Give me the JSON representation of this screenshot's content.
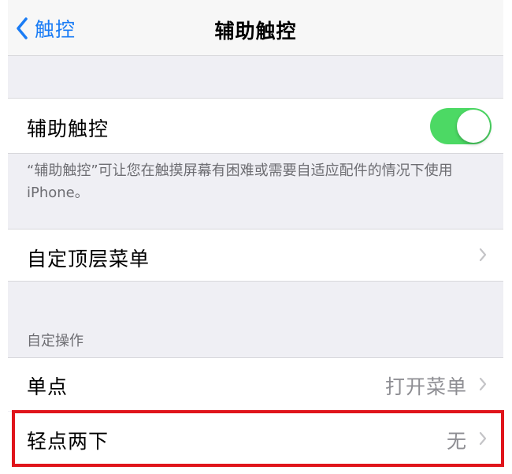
{
  "navbar": {
    "back_label": "触控",
    "title": "辅助触控"
  },
  "assistive_touch": {
    "label": "辅助触控",
    "toggle_on": true,
    "footer": "“辅助触控”可让您在触摸屏幕有困难或需要自适应配件的情况下使用iPhone。"
  },
  "top_menu": {
    "label": "自定顶层菜单"
  },
  "custom_actions": {
    "header": "自定操作",
    "items": [
      {
        "label": "单点",
        "value": "打开菜单"
      },
      {
        "label": "轻点两下",
        "value": "无"
      }
    ]
  },
  "colors": {
    "accent": "#1a7cf5",
    "toggle_on": "#4cd964",
    "highlight": "#e0141b"
  }
}
